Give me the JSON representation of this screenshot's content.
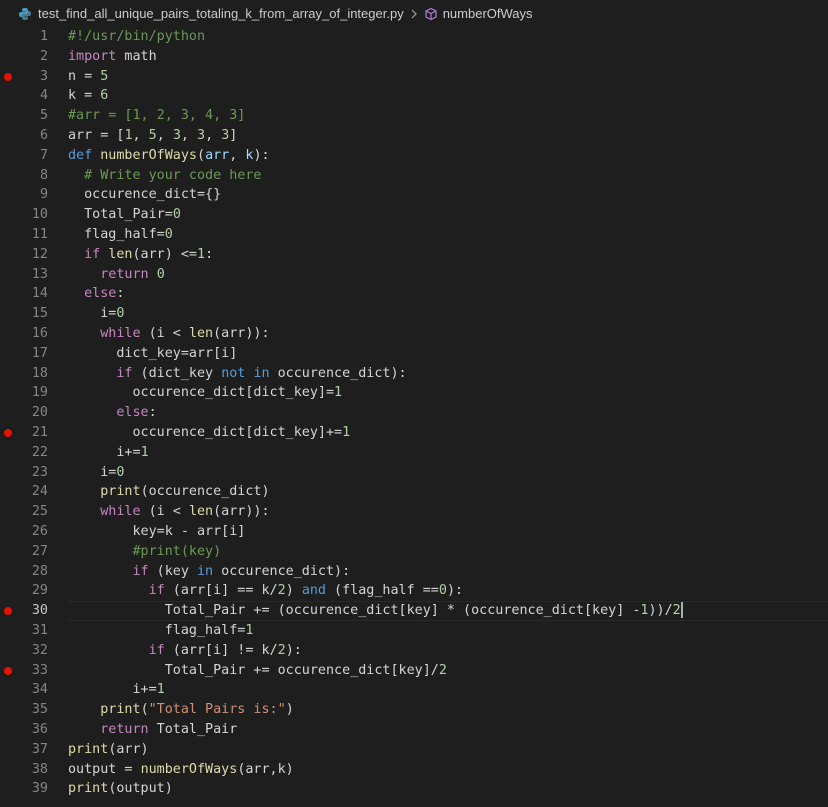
{
  "breadcrumb": {
    "file": "test_find_all_unique_pairs_totaling_k_from_array_of_integer.py",
    "symbol": "numberOfWays"
  },
  "editor": {
    "breakpoints": [
      3,
      21,
      30,
      33
    ],
    "current_line": 30,
    "lines": [
      {
        "n": "1",
        "tokens": [
          [
            "c",
            "#!/usr/bin/python"
          ]
        ]
      },
      {
        "n": "2",
        "tokens": [
          [
            "k",
            "import"
          ],
          [
            "p",
            " math"
          ]
        ]
      },
      {
        "n": "3",
        "tokens": [
          [
            "p",
            "n = "
          ],
          [
            "n",
            "5"
          ]
        ]
      },
      {
        "n": "4",
        "tokens": [
          [
            "p",
            "k = "
          ],
          [
            "n",
            "6"
          ]
        ]
      },
      {
        "n": "5",
        "tokens": [
          [
            "c",
            "#arr = [1, 2, 3, 4, 3]"
          ]
        ]
      },
      {
        "n": "6",
        "tokens": [
          [
            "p",
            "arr = ["
          ],
          [
            "n",
            "1"
          ],
          [
            "p",
            ", "
          ],
          [
            "n",
            "5"
          ],
          [
            "p",
            ", "
          ],
          [
            "n",
            "3"
          ],
          [
            "p",
            ", "
          ],
          [
            "n",
            "3"
          ],
          [
            "p",
            ", "
          ],
          [
            "n",
            "3"
          ],
          [
            "p",
            "]"
          ]
        ]
      },
      {
        "n": "7",
        "tokens": [
          [
            "b",
            "def"
          ],
          [
            "p",
            " "
          ],
          [
            "f",
            "numberOfWays"
          ],
          [
            "p",
            "("
          ],
          [
            "v",
            "arr"
          ],
          [
            "p",
            ", "
          ],
          [
            "v",
            "k"
          ],
          [
            "p",
            "):"
          ]
        ]
      },
      {
        "n": "8",
        "tokens": [
          [
            "p",
            "  "
          ],
          [
            "c",
            "# Write your code here"
          ]
        ]
      },
      {
        "n": "9",
        "tokens": [
          [
            "p",
            "  occurence_dict={}"
          ]
        ]
      },
      {
        "n": "10",
        "tokens": [
          [
            "p",
            "  Total_Pair="
          ],
          [
            "n",
            "0"
          ]
        ]
      },
      {
        "n": "11",
        "tokens": [
          [
            "p",
            "  flag_half="
          ],
          [
            "n",
            "0"
          ]
        ]
      },
      {
        "n": "12",
        "tokens": [
          [
            "p",
            "  "
          ],
          [
            "k",
            "if"
          ],
          [
            "p",
            " "
          ],
          [
            "f",
            "len"
          ],
          [
            "p",
            "(arr) <="
          ],
          [
            "n",
            "1"
          ],
          [
            "p",
            ":"
          ]
        ]
      },
      {
        "n": "13",
        "tokens": [
          [
            "p",
            "    "
          ],
          [
            "k",
            "return"
          ],
          [
            "p",
            " "
          ],
          [
            "n",
            "0"
          ]
        ]
      },
      {
        "n": "14",
        "tokens": [
          [
            "p",
            "  "
          ],
          [
            "k",
            "else"
          ],
          [
            "p",
            ":"
          ]
        ]
      },
      {
        "n": "15",
        "tokens": [
          [
            "p",
            "    i="
          ],
          [
            "n",
            "0"
          ]
        ]
      },
      {
        "n": "16",
        "tokens": [
          [
            "p",
            "    "
          ],
          [
            "k",
            "while"
          ],
          [
            "p",
            " (i < "
          ],
          [
            "f",
            "len"
          ],
          [
            "p",
            "(arr)):"
          ]
        ]
      },
      {
        "n": "17",
        "tokens": [
          [
            "p",
            "      dict_key=arr[i]"
          ]
        ]
      },
      {
        "n": "18",
        "tokens": [
          [
            "p",
            "      "
          ],
          [
            "k",
            "if"
          ],
          [
            "p",
            " (dict_key "
          ],
          [
            "b",
            "not"
          ],
          [
            "p",
            " "
          ],
          [
            "b",
            "in"
          ],
          [
            "p",
            " occurence_dict):"
          ]
        ]
      },
      {
        "n": "19",
        "tokens": [
          [
            "p",
            "        occurence_dict[dict_key]="
          ],
          [
            "n",
            "1"
          ]
        ]
      },
      {
        "n": "20",
        "tokens": [
          [
            "p",
            "      "
          ],
          [
            "k",
            "else"
          ],
          [
            "p",
            ":"
          ]
        ]
      },
      {
        "n": "21",
        "tokens": [
          [
            "p",
            "        occurence_dict[dict_key]+="
          ],
          [
            "n",
            "1"
          ]
        ]
      },
      {
        "n": "22",
        "tokens": [
          [
            "p",
            "      i+="
          ],
          [
            "n",
            "1"
          ]
        ]
      },
      {
        "n": "23",
        "tokens": [
          [
            "p",
            "    i="
          ],
          [
            "n",
            "0"
          ]
        ]
      },
      {
        "n": "24",
        "tokens": [
          [
            "p",
            "    "
          ],
          [
            "f",
            "print"
          ],
          [
            "p",
            "(occurence_dict)"
          ]
        ]
      },
      {
        "n": "25",
        "tokens": [
          [
            "p",
            "    "
          ],
          [
            "k",
            "while"
          ],
          [
            "p",
            " (i < "
          ],
          [
            "f",
            "len"
          ],
          [
            "p",
            "(arr)):"
          ]
        ]
      },
      {
        "n": "26",
        "tokens": [
          [
            "p",
            "        key=k - arr[i]"
          ]
        ]
      },
      {
        "n": "27",
        "tokens": [
          [
            "p",
            "        "
          ],
          [
            "c",
            "#print(key)"
          ]
        ]
      },
      {
        "n": "28",
        "tokens": [
          [
            "p",
            "        "
          ],
          [
            "k",
            "if"
          ],
          [
            "p",
            " (key "
          ],
          [
            "b",
            "in"
          ],
          [
            "p",
            " occurence_dict):"
          ]
        ]
      },
      {
        "n": "29",
        "tokens": [
          [
            "p",
            "          "
          ],
          [
            "k",
            "if"
          ],
          [
            "p",
            " (arr[i] == k/"
          ],
          [
            "n",
            "2"
          ],
          [
            "p",
            ") "
          ],
          [
            "b",
            "and"
          ],
          [
            "p",
            " (flag_half =="
          ],
          [
            "n",
            "0"
          ],
          [
            "p",
            "):"
          ]
        ]
      },
      {
        "n": "30",
        "tokens": [
          [
            "p",
            "            Total_Pair += (occurence_dict[key] * (occurence_dict[key] -"
          ],
          [
            "n",
            "1"
          ],
          [
            "p",
            "))/"
          ],
          [
            "n",
            "2"
          ]
        ]
      },
      {
        "n": "31",
        "tokens": [
          [
            "p",
            "            flag_half="
          ],
          [
            "n",
            "1"
          ]
        ]
      },
      {
        "n": "32",
        "tokens": [
          [
            "p",
            "          "
          ],
          [
            "k",
            "if"
          ],
          [
            "p",
            " (arr[i] != k/"
          ],
          [
            "n",
            "2"
          ],
          [
            "p",
            "):"
          ]
        ]
      },
      {
        "n": "33",
        "tokens": [
          [
            "p",
            "            Total_Pair += occurence_dict[key]/"
          ],
          [
            "n",
            "2"
          ]
        ]
      },
      {
        "n": "34",
        "tokens": [
          [
            "p",
            "        i+="
          ],
          [
            "n",
            "1"
          ]
        ]
      },
      {
        "n": "35",
        "tokens": [
          [
            "p",
            "    "
          ],
          [
            "f",
            "print"
          ],
          [
            "p",
            "("
          ],
          [
            "s",
            "\"Total Pairs is:\""
          ],
          [
            "p",
            ")"
          ]
        ]
      },
      {
        "n": "36",
        "tokens": [
          [
            "p",
            "    "
          ],
          [
            "k",
            "return"
          ],
          [
            "p",
            " Total_Pair"
          ]
        ]
      },
      {
        "n": "37",
        "tokens": [
          [
            "f",
            "print"
          ],
          [
            "p",
            "(arr)"
          ]
        ]
      },
      {
        "n": "38",
        "tokens": [
          [
            "p",
            "output = "
          ],
          [
            "f",
            "numberOfWays"
          ],
          [
            "p",
            "(arr,k)"
          ]
        ]
      },
      {
        "n": "39",
        "tokens": [
          [
            "f",
            "print"
          ],
          [
            "p",
            "(output)"
          ]
        ]
      }
    ]
  }
}
